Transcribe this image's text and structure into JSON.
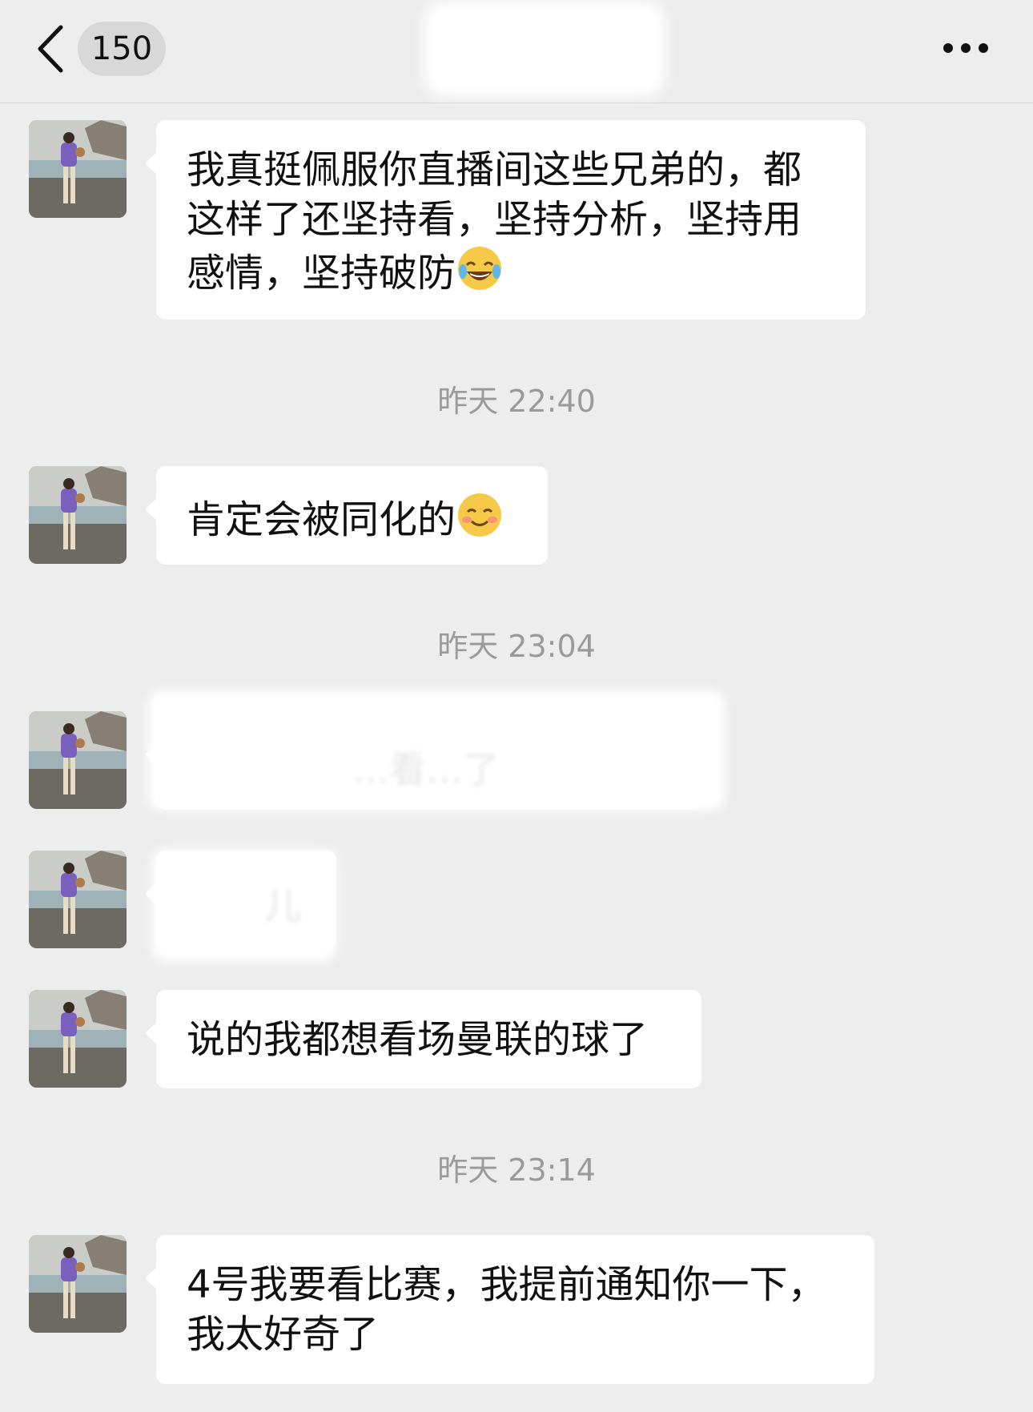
{
  "header": {
    "unread_count": "150"
  },
  "messages": [
    {
      "text": "我真挺佩服你直播间这些兄弟的，都这样了还坚持看，坚持分析，坚持用感情，坚持破防",
      "emoji": "laughing-tears-emoji"
    },
    {
      "text": "肯定会被同化的",
      "emoji": "smiling-blush-emoji"
    },
    {
      "text": "说的我都想看场曼联的球了"
    },
    {
      "text": "4号我要看比赛，我提前通知你一下，我太好奇了"
    }
  ],
  "timestamps": [
    "昨天 22:40",
    "昨天 23:04",
    "昨天 23:14"
  ],
  "redacted": {
    "fragment_1": "…看…了",
    "fragment_2": "儿"
  },
  "colors": {
    "background": "#ededed",
    "bubble": "#ffffff",
    "timestamp": "#9a9a9a"
  }
}
